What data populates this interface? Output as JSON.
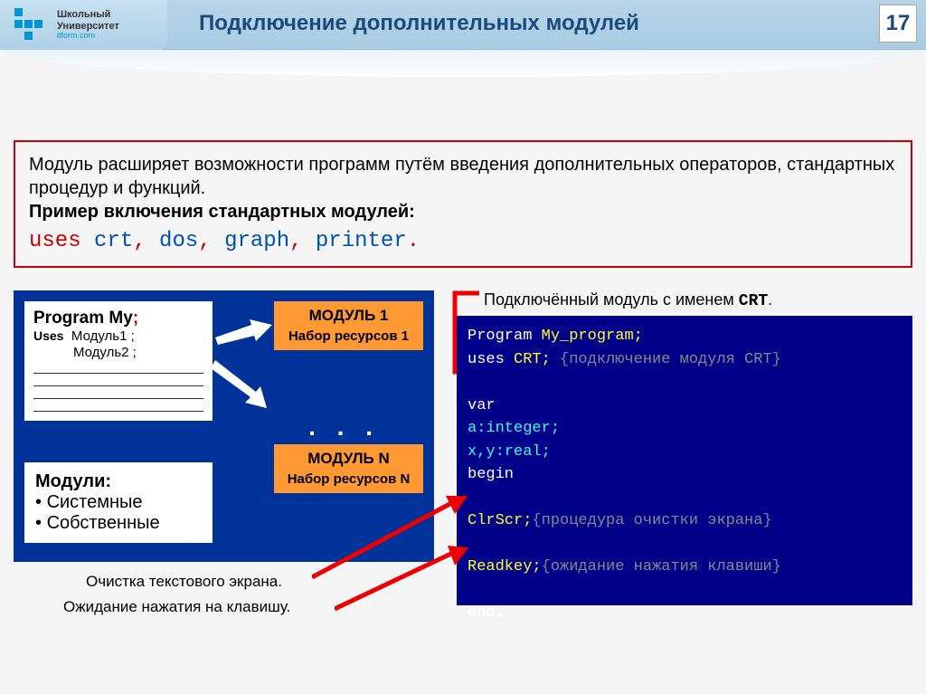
{
  "header": {
    "logo_line1": "Школьный",
    "logo_line2": "Университет",
    "logo_sub": "itform.com",
    "title": "Подключение дополнительных модулей",
    "page_number": "17"
  },
  "info_box": {
    "line1": "Модуль расширяет возможности программ путём введения дополнительных операторов, стандартных процедур и функций.",
    "line2": "Пример включения стандартных модулей:",
    "uses_kw": "uses",
    "mod1": "crt",
    "mod2": "dos",
    "mod3": "graph",
    "mod4": "printer",
    "sep": ", ",
    "end": "."
  },
  "diagram": {
    "prog_title": "Program My",
    "semicolon": ";",
    "uses_label": "Uses",
    "mod_a": "Модуль1 ;",
    "mod_b": "Модуль2 ;",
    "module1_title": "МОДУЛЬ 1",
    "module1_sub": "Набор ресурсов 1",
    "moduleN_title": "МОДУЛЬ N",
    "moduleN_sub": "Набор ресурсов N",
    "dots": ". . .",
    "types_title": "Модули:",
    "type1": "Системные",
    "type2": "Собственные"
  },
  "right": {
    "crt_label_pre": "Подключённый модуль с именем ",
    "crt_label_bold": "CRT",
    "crt_label_post": "."
  },
  "terminal": {
    "l1a": "Program",
    "l1b": " My_program;",
    "l2a": "uses",
    "l2b": " CRT;",
    "l2c": " {подключение модуля CRT}",
    "l3": "var",
    "l4": "    a:integer;",
    "l5": "    x,y:real;",
    "l6": "begin",
    "l7a": "ClrScr;",
    "l7b": "{процедура очистки экрана}",
    "l8a": "Readkey;",
    "l8b": "{ожидание нажатия клавиши}",
    "l9": "end."
  },
  "captions": {
    "c1": "Очистка текстового экрана.",
    "c2": "Ожидание нажатия на клавишу."
  }
}
